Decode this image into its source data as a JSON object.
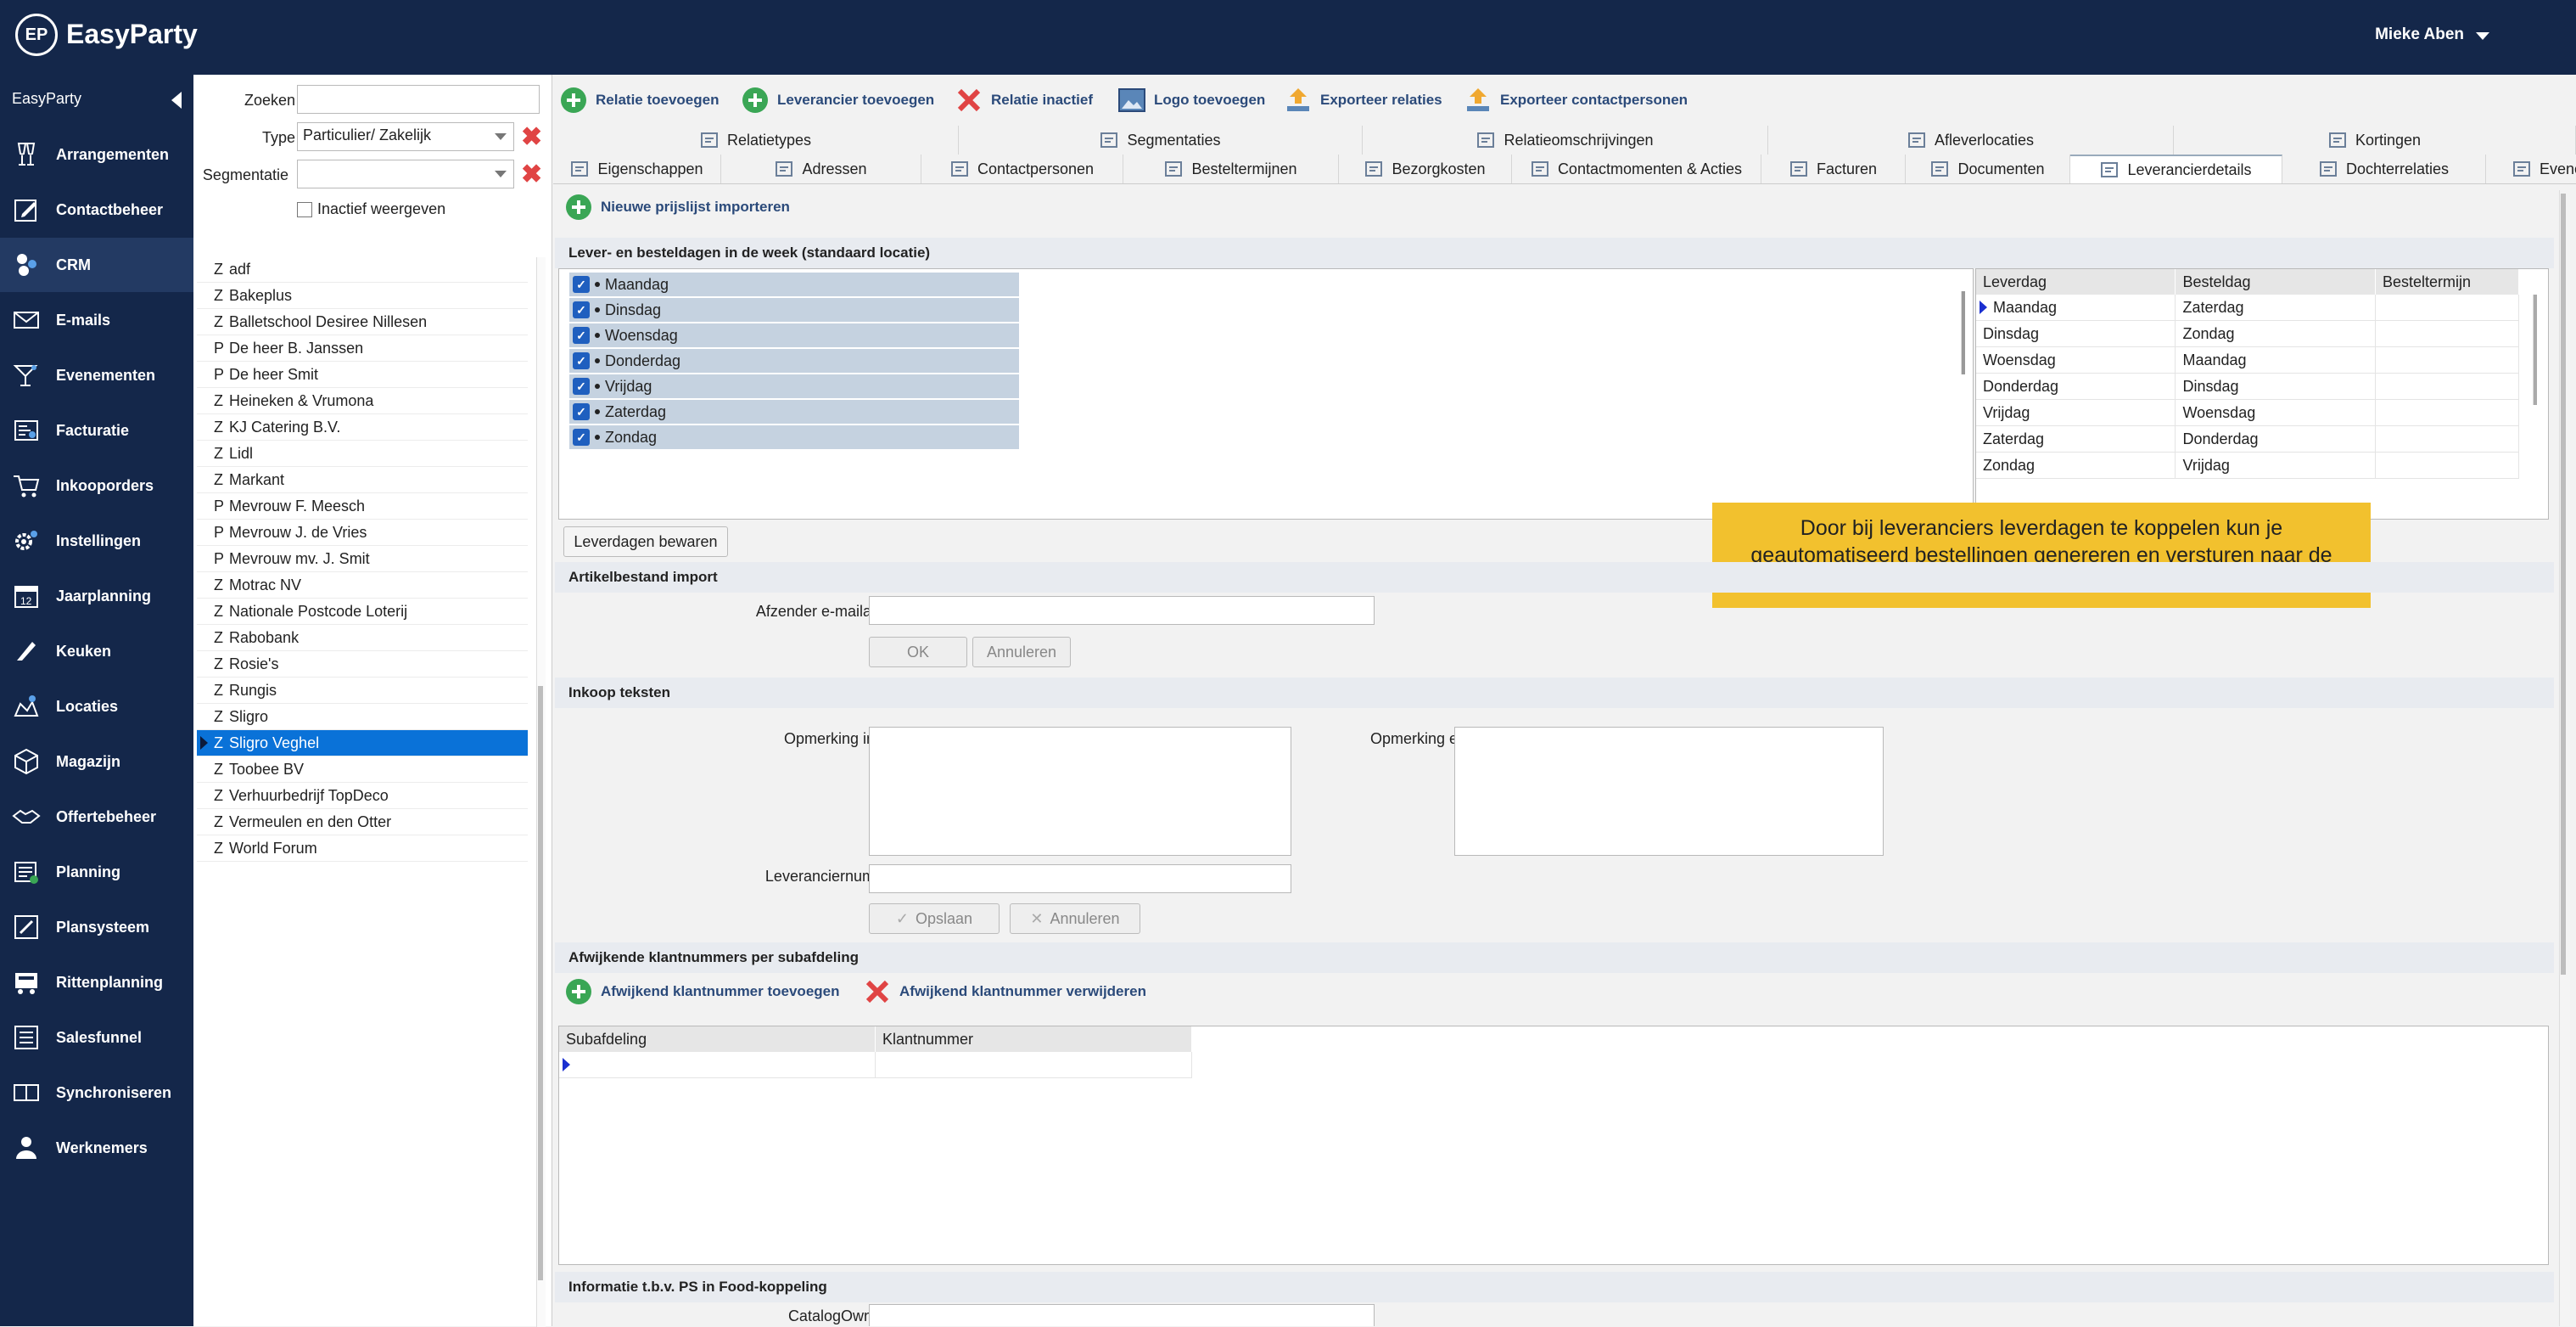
{
  "app": {
    "logo_text": "EP",
    "name": "EasyParty",
    "user": "Mieke Aben"
  },
  "sidebar": {
    "title": "EasyParty",
    "items": [
      {
        "label": "Arrangementen",
        "icon": "glasses-icon"
      },
      {
        "label": "Contactbeheer",
        "icon": "contact-icon"
      },
      {
        "label": "CRM",
        "icon": "crm-icon",
        "active": true
      },
      {
        "label": "E-mails",
        "icon": "envelope-icon"
      },
      {
        "label": "Evenementen",
        "icon": "cocktail-icon"
      },
      {
        "label": "Facturatie",
        "icon": "invoice-icon"
      },
      {
        "label": "Inkooporders",
        "icon": "cart-icon"
      },
      {
        "label": "Instellingen",
        "icon": "gear-icon"
      },
      {
        "label": "Jaarplanning",
        "icon": "calendar-icon"
      },
      {
        "label": "Keuken",
        "icon": "knife-icon"
      },
      {
        "label": "Locaties",
        "icon": "location-icon"
      },
      {
        "label": "Magazijn",
        "icon": "box-icon"
      },
      {
        "label": "Offertebeheer",
        "icon": "handshake-icon"
      },
      {
        "label": "Planning",
        "icon": "planning-icon"
      },
      {
        "label": "Plansysteem",
        "icon": "plansystem-icon"
      },
      {
        "label": "Rittenplanning",
        "icon": "truck-icon"
      },
      {
        "label": "Salesfunnel",
        "icon": "funnel-icon"
      },
      {
        "label": "Synchroniseren",
        "icon": "sync-icon"
      },
      {
        "label": "Werknemers",
        "icon": "employees-icon"
      }
    ]
  },
  "filters": {
    "search_label": "Zoeken",
    "search_value": "",
    "type_label": "Type",
    "type_value": "Particulier/ Zakelijk",
    "segment_label": "Segmentatie",
    "segment_value": "",
    "inactive_label": "Inactief weergeven"
  },
  "relations": [
    {
      "t": "Z",
      "name": "adf"
    },
    {
      "t": "Z",
      "name": "Bakeplus"
    },
    {
      "t": "Z",
      "name": "Balletschool Desiree Nillesen"
    },
    {
      "t": "P",
      "name": "De heer B. Janssen"
    },
    {
      "t": "P",
      "name": "De heer Smit"
    },
    {
      "t": "Z",
      "name": "Heineken & Vrumona"
    },
    {
      "t": "Z",
      "name": "KJ Catering B.V."
    },
    {
      "t": "Z",
      "name": "Lidl"
    },
    {
      "t": "Z",
      "name": "Markant"
    },
    {
      "t": "P",
      "name": "Mevrouw F. Meesch"
    },
    {
      "t": "P",
      "name": "Mevrouw J. de Vries"
    },
    {
      "t": "P",
      "name": "Mevrouw mv. J. Smit"
    },
    {
      "t": "Z",
      "name": "Motrac NV"
    },
    {
      "t": "Z",
      "name": "Nationale Postcode Loterij"
    },
    {
      "t": "Z",
      "name": "Rabobank"
    },
    {
      "t": "Z",
      "name": "Rosie's"
    },
    {
      "t": "Z",
      "name": "Rungis"
    },
    {
      "t": "Z",
      "name": "Sligro"
    },
    {
      "t": "Z",
      "name": "Sligro Veghel",
      "selected": true
    },
    {
      "t": "Z",
      "name": "Toobee BV"
    },
    {
      "t": "Z",
      "name": "Verhuurbedrijf TopDeco"
    },
    {
      "t": "Z",
      "name": "Vermeulen en den Otter"
    },
    {
      "t": "Z",
      "name": "World Forum"
    }
  ],
  "toolbar": {
    "add_relation": "Relatie toevoegen",
    "add_supplier": "Leverancier toevoegen",
    "relation_inactive": "Relatie inactief",
    "add_logo": "Logo toevoegen",
    "export_relations": "Exporteer relaties",
    "export_contacts": "Exporteer contactpersonen"
  },
  "tabs_row1": [
    "Relatietypes",
    "Segmentaties",
    "Relatieomschrijvingen",
    "Afleverlocaties",
    "Kortingen"
  ],
  "tabs_row2": [
    "Eigenschappen",
    "Adressen",
    "Contactpersonen",
    "Besteltermijnen",
    "Bezorgkosten",
    "Contactmomenten & Acties",
    "Facturen",
    "Documenten",
    "Leverancierdetails",
    "Dochterrelaties",
    "Evenementen"
  ],
  "active_tab": "Leverancierdetails",
  "content": {
    "import_pricelist": "Nieuwe prijslijst importeren",
    "days_section": "Lever- en besteldagen in de week (standaard locatie)",
    "days": [
      "Maandag",
      "Dinsdag",
      "Woensdag",
      "Donderdag",
      "Vrijdag",
      "Zaterdag",
      "Zondag"
    ],
    "schedule_headers": [
      "Leverdag",
      "Besteldag",
      "Besteltermijn"
    ],
    "schedule": [
      [
        "Maandag",
        "Zaterdag",
        ""
      ],
      [
        "Dinsdag",
        "Zondag",
        ""
      ],
      [
        "Woensdag",
        "Maandag",
        ""
      ],
      [
        "Donderdag",
        "Dinsdag",
        ""
      ],
      [
        "Vrijdag",
        "Woensdag",
        ""
      ],
      [
        "Zaterdag",
        "Donderdag",
        ""
      ],
      [
        "Zondag",
        "Vrijdag",
        ""
      ]
    ],
    "tooltip": "Door bij leveranciers leverdagen te koppelen kun je geautomatiseerd bestellingen genereren en versturen naar de leverancier.",
    "save_days": "Leverdagen bewaren",
    "article_section": "Artikelbestand import",
    "sender_label": "Afzender e-mailadres",
    "sender_value": "",
    "ok": "OK",
    "cancel": "Annuleren",
    "purchase_section": "Inkoop teksten",
    "remark_intern": "Opmerking intern",
    "remark_extern": "Opmerking extern",
    "supplier_number_label": "Leveranciernummer",
    "supplier_number_value": "",
    "save": "Opslaan",
    "cancel2": "Annuleren",
    "deviating_section": "Afwijkende klantnummers per subafdeling",
    "add_deviating": "Afwijkend klantnummer toevoegen",
    "remove_deviating": "Afwijkend klantnummer verwijderen",
    "sub_headers": [
      "Subafdeling",
      "Klantnummer"
    ],
    "ps_section": "Informatie t.b.v. PS in Food-koppeling",
    "catalog_label": "CatalogOwnerID"
  },
  "colors": {
    "navy": "#14274a",
    "selection": "#0a72d8",
    "tooltip": "#f2c12e",
    "add_green": "#3aa655",
    "remove_red": "#e04444"
  }
}
